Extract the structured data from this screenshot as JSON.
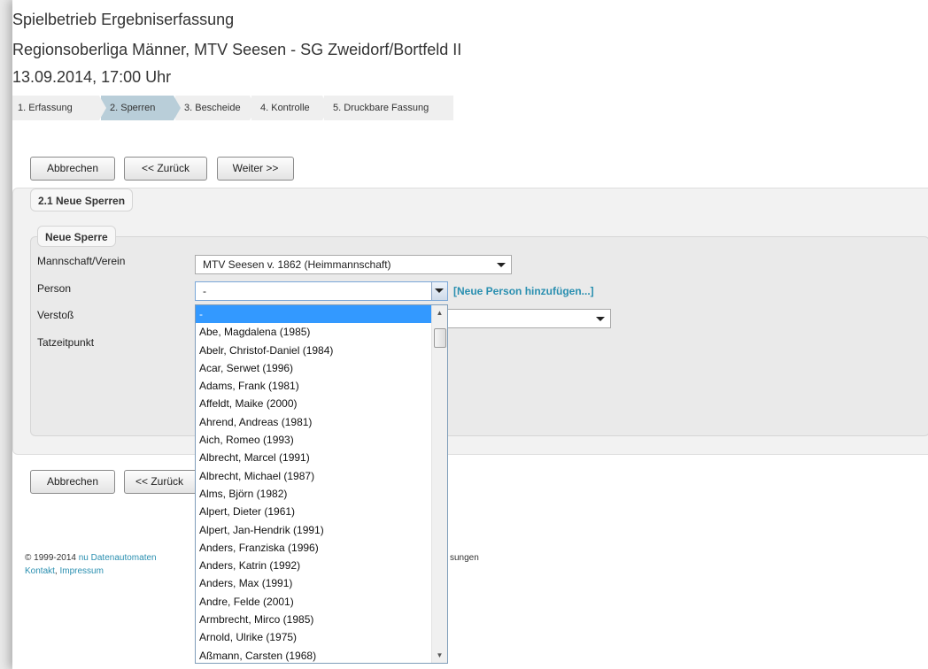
{
  "header": {
    "line1": "Spielbetrieb Ergebniserfassung",
    "line2": "Regionsoberliga Männer, MTV Seesen - SG Zweidorf/Bortfeld II",
    "line3": "13.09.2014, 17:00 Uhr"
  },
  "steps": [
    {
      "label": "1. Erfassung"
    },
    {
      "label": "2. Sperren"
    },
    {
      "label": "3. Bescheide"
    },
    {
      "label": "4. Kontrolle"
    },
    {
      "label": "5. Druckbare Fassung"
    }
  ],
  "buttons": {
    "cancel": "Abbrechen",
    "back": "<< Zurück",
    "next": "Weiter >>"
  },
  "section": {
    "title": "2.1 Neue Sperren",
    "subtitle": "Neue Sperre"
  },
  "form": {
    "team_label": "Mannschaft/Verein",
    "team_value": "MTV Seesen v. 1862 (Heimmannschaft)",
    "person_label": "Person",
    "person_value": "-",
    "add_person_link": "[Neue Person hinzufügen...]",
    "violation_label": "Verstoß",
    "time_label": "Tatzeitpunkt"
  },
  "dropdown": {
    "options": [
      "-",
      "Abe, Magdalena (1985)",
      "Abelr, Christof-Daniel (1984)",
      "Acar, Serwet (1996)",
      "Adams, Frank (1981)",
      "Affeldt, Maike (2000)",
      "Ahrend, Andreas (1981)",
      "Aich, Romeo (1993)",
      "Albrecht, Marcel (1991)",
      "Albrecht, Michael (1987)",
      "Alms, Björn (1982)",
      "Alpert, Dieter (1961)",
      "Alpert, Jan-Hendrik (1991)",
      "Anders, Franziska (1996)",
      "Anders, Katrin (1992)",
      "Anders, Max (1991)",
      "Andre, Felde (2001)",
      "Armbrecht, Mirco (1985)",
      "Arnold, Ulrike (1975)",
      "Aßmann, Carsten (1968)"
    ]
  },
  "footer": {
    "copyright": "© 1999-2014",
    "company_start": "nu Datenautomaten",
    "company_end": "sungen",
    "contact": "Kontakt",
    "separator": ",",
    "imprint": "Impressum"
  }
}
